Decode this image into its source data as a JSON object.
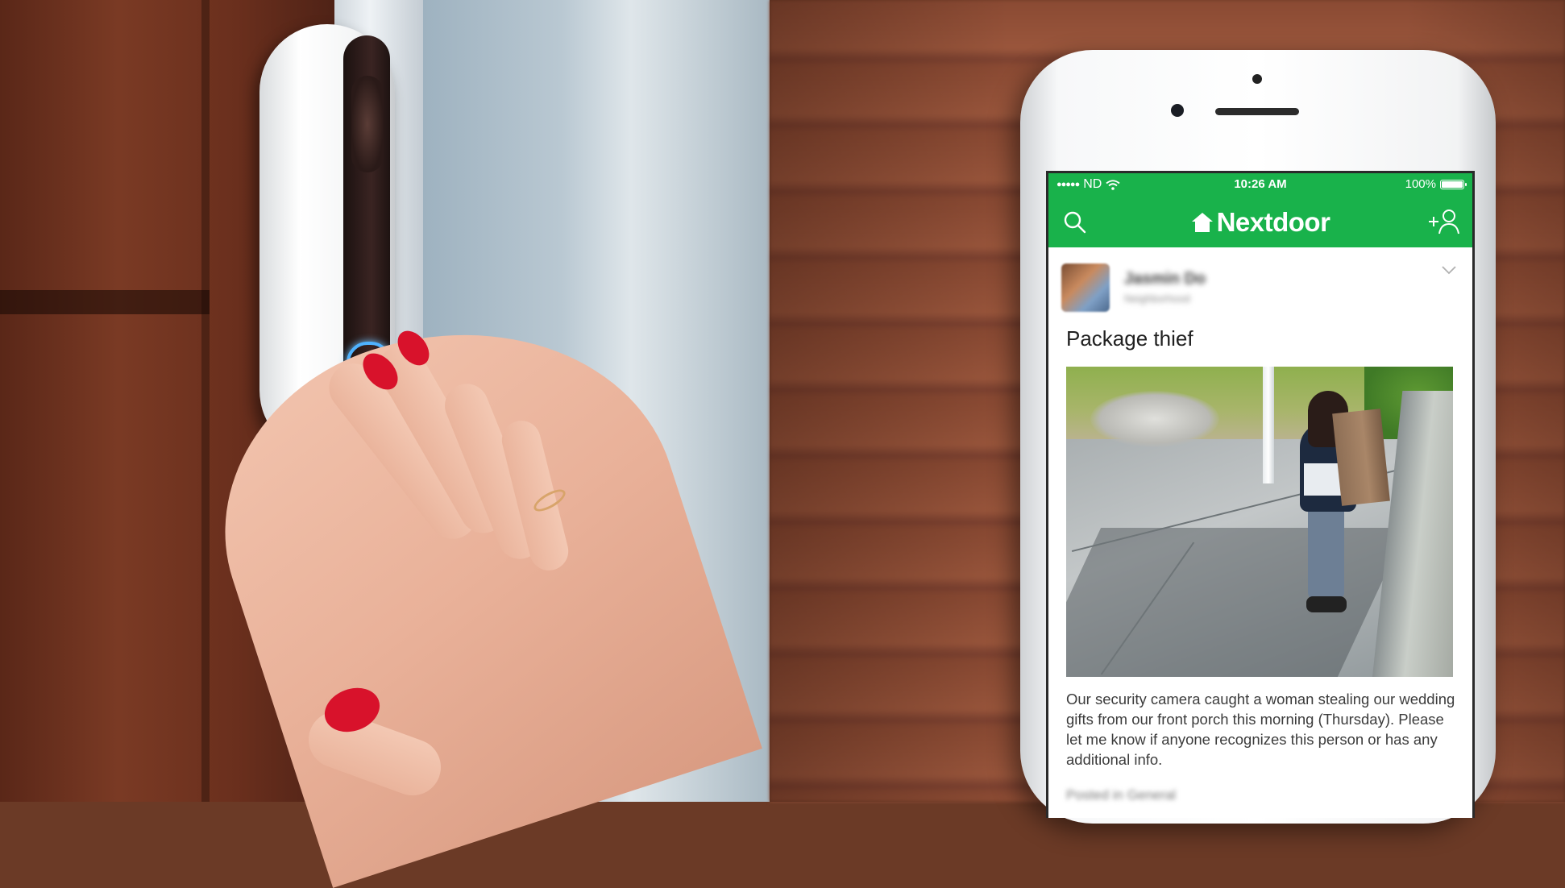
{
  "status_bar": {
    "carrier": "ND",
    "time": "10:26 AM",
    "battery": "100%"
  },
  "navbar": {
    "brand": "Nextdoor",
    "icons": [
      "search-icon",
      "house-icon",
      "add-user-icon"
    ]
  },
  "post": {
    "author_name": "Jasmin Do",
    "author_meta": "Neighborhood",
    "title": "Package thief",
    "image_icon": "security-camera-photo",
    "body": "Our security camera caught a woman stealing our wedding gifts from our front porch this morning (Thursday). Please let me know if anyone recognizes this person or has any additional info.",
    "footer": "Posted in General"
  },
  "colors": {
    "brand_green": "#19b24b",
    "ring_blue": "#4fb3ff",
    "nail_red": "#d8122b"
  }
}
